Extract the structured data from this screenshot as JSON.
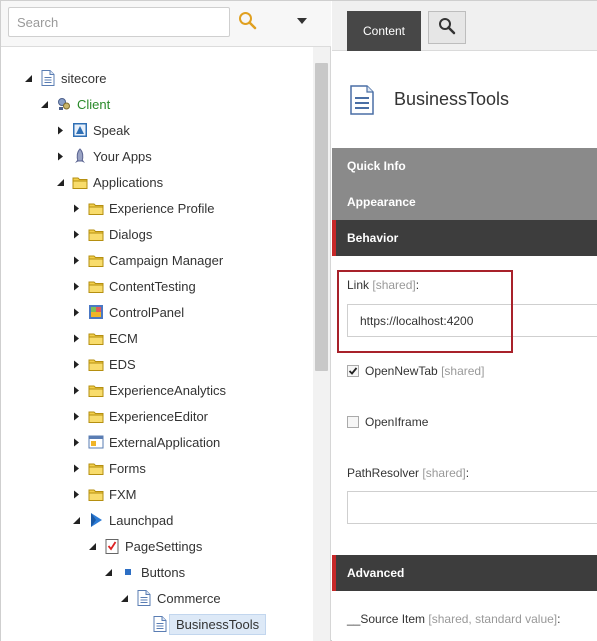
{
  "search": {
    "placeholder": "Search",
    "value": ""
  },
  "tree": {
    "nodes": [
      {
        "label": "sitecore",
        "icon": "page-icon",
        "twisty": "expanded"
      },
      {
        "label": "Client",
        "icon": "client-icon",
        "twisty": "expanded",
        "color": "#2a8a2a"
      },
      {
        "label": "Speak",
        "icon": "speak-icon",
        "twisty": "collapsed"
      },
      {
        "label": "Your Apps",
        "icon": "rocket-icon",
        "twisty": "collapsed"
      },
      {
        "label": "Applications",
        "icon": "folder-icon",
        "twisty": "expanded"
      },
      {
        "label": "Experience Profile",
        "icon": "folder-icon",
        "twisty": "collapsed"
      },
      {
        "label": "Dialogs",
        "icon": "folder-icon",
        "twisty": "collapsed"
      },
      {
        "label": "Campaign Manager",
        "icon": "folder-icon",
        "twisty": "collapsed"
      },
      {
        "label": "ContentTesting",
        "icon": "folder-icon",
        "twisty": "collapsed"
      },
      {
        "label": "ControlPanel",
        "icon": "control-panel-icon",
        "twisty": "collapsed"
      },
      {
        "label": "ECM",
        "icon": "folder-icon",
        "twisty": "collapsed"
      },
      {
        "label": "EDS",
        "icon": "folder-icon",
        "twisty": "collapsed"
      },
      {
        "label": "ExperienceAnalytics",
        "icon": "folder-icon",
        "twisty": "collapsed"
      },
      {
        "label": "ExperienceEditor",
        "icon": "folder-icon",
        "twisty": "collapsed"
      },
      {
        "label": "ExternalApplication",
        "icon": "window-icon",
        "twisty": "collapsed"
      },
      {
        "label": "Forms",
        "icon": "folder-icon",
        "twisty": "collapsed"
      },
      {
        "label": "FXM",
        "icon": "folder-icon",
        "twisty": "collapsed"
      },
      {
        "label": "Launchpad",
        "icon": "launchpad-icon",
        "twisty": "expanded"
      },
      {
        "label": "PageSettings",
        "icon": "checklist-icon",
        "twisty": "expanded"
      },
      {
        "label": "Buttons",
        "icon": "square-icon",
        "twisty": "expanded"
      },
      {
        "label": "Commerce",
        "icon": "page-icon",
        "twisty": "expanded"
      },
      {
        "label": "BusinessTools",
        "icon": "page-icon",
        "twisty": "none",
        "selected": true
      }
    ]
  },
  "toolbar": {
    "content_tab": "Content",
    "search_icon": "search-icon"
  },
  "item": {
    "title": "BusinessTools"
  },
  "sections": {
    "quick_info": "Quick Info",
    "appearance": "Appearance",
    "behavior": "Behavior",
    "advanced": "Advanced"
  },
  "fields": {
    "link": {
      "label": "Link",
      "meta": "[shared]",
      "suffix": ":",
      "value": "https://localhost:4200"
    },
    "open_new_tab": {
      "label": "OpenNewTab",
      "meta": "[shared]",
      "checked": true
    },
    "open_iframe": {
      "label": "OpenIframe",
      "checked": false
    },
    "path_resolver": {
      "label": "PathResolver",
      "meta": "[shared]",
      "suffix": ":",
      "value": ""
    },
    "source_item": {
      "label": "__Source Item",
      "meta": "[shared, standard value]",
      "suffix": ":"
    }
  },
  "colors": {
    "accent_red": "#a8212a",
    "section_dark": "#3d3d3d",
    "section_grey": "#8a8a8a",
    "tab_dark": "#474747",
    "tree_green": "#2a8a2a"
  }
}
